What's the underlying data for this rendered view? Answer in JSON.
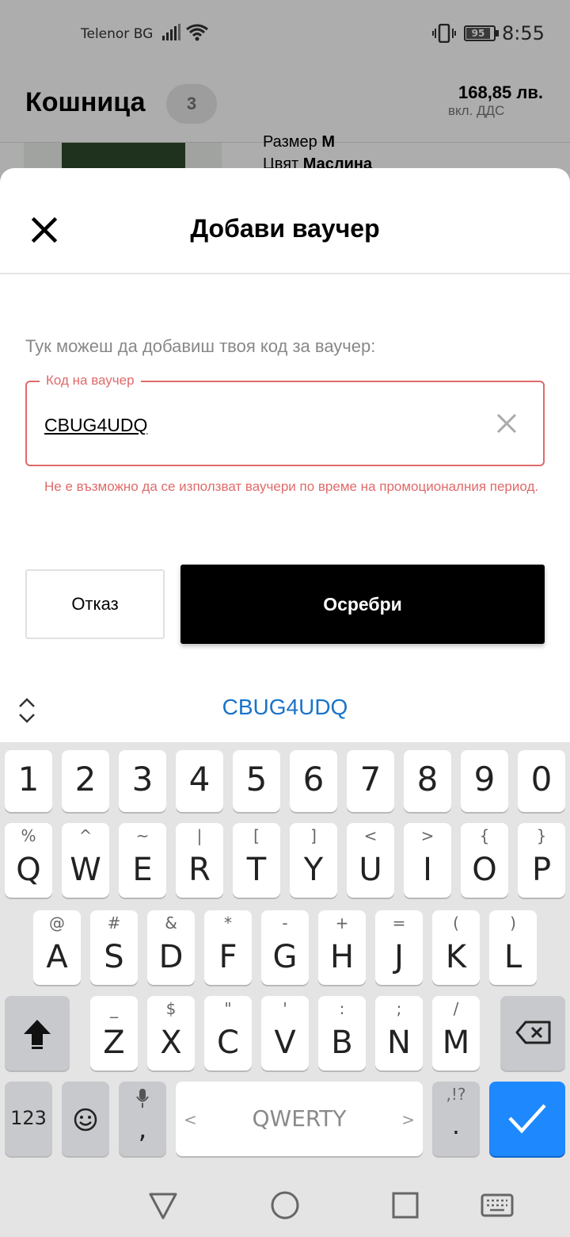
{
  "status_bar": {
    "carrier": "Telenor BG",
    "battery": "95",
    "time": "8:55",
    "icons": [
      "signal-icon",
      "wifi-icon",
      "vibrate-icon",
      "battery-icon"
    ]
  },
  "cart": {
    "title": "Кошница",
    "count": "3",
    "total": "168,85 лв.",
    "vat_note": "вкл. ДДС",
    "product": {
      "size_label": "Размер",
      "size": "M",
      "color_label": "Цвят",
      "color": "Маслина"
    }
  },
  "sheet": {
    "title": "Добави ваучер",
    "hint": "Тук можеш да добавиш твоя код за ваучер:",
    "field_label": "Код на ваучер",
    "field_value": "CBUG4UDQ",
    "error": "Не е възможно да се използват ваучери по време на промоционалния период.",
    "cancel": "Отказ",
    "apply": "Осребри"
  },
  "suggestion": "CBUG4UDQ",
  "keyboard": {
    "number_row": [
      "1",
      "2",
      "3",
      "4",
      "5",
      "6",
      "7",
      "8",
      "9",
      "0"
    ],
    "row1": [
      {
        "k": "Q",
        "s": "%"
      },
      {
        "k": "W",
        "s": "^"
      },
      {
        "k": "E",
        "s": "~"
      },
      {
        "k": "R",
        "s": "|"
      },
      {
        "k": "T",
        "s": "["
      },
      {
        "k": "Y",
        "s": "]"
      },
      {
        "k": "U",
        "s": "<"
      },
      {
        "k": "I",
        "s": ">"
      },
      {
        "k": "O",
        "s": "{"
      },
      {
        "k": "P",
        "s": "}"
      }
    ],
    "row2": [
      {
        "k": "A",
        "s": "@"
      },
      {
        "k": "S",
        "s": "#"
      },
      {
        "k": "D",
        "s": "&"
      },
      {
        "k": "F",
        "s": "*"
      },
      {
        "k": "G",
        "s": "-"
      },
      {
        "k": "H",
        "s": "+"
      },
      {
        "k": "J",
        "s": "="
      },
      {
        "k": "K",
        "s": "("
      },
      {
        "k": "L",
        "s": ")"
      }
    ],
    "row3": [
      {
        "k": "Z",
        "s": "_"
      },
      {
        "k": "X",
        "s": "$"
      },
      {
        "k": "C",
        "s": "\""
      },
      {
        "k": "V",
        "s": "'"
      },
      {
        "k": "B",
        "s": ":"
      },
      {
        "k": "N",
        "s": ";"
      },
      {
        "k": "M",
        "s": "/"
      }
    ],
    "sym_key": "123",
    "comma": ",",
    "space_label": "QWERTY",
    "period": ".",
    "period_sub": ",!?",
    "space_left_arrow": "<",
    "space_right_arrow": ">"
  },
  "nav": [
    "back-icon",
    "home-icon",
    "recents-icon",
    "keyboard-icon"
  ]
}
